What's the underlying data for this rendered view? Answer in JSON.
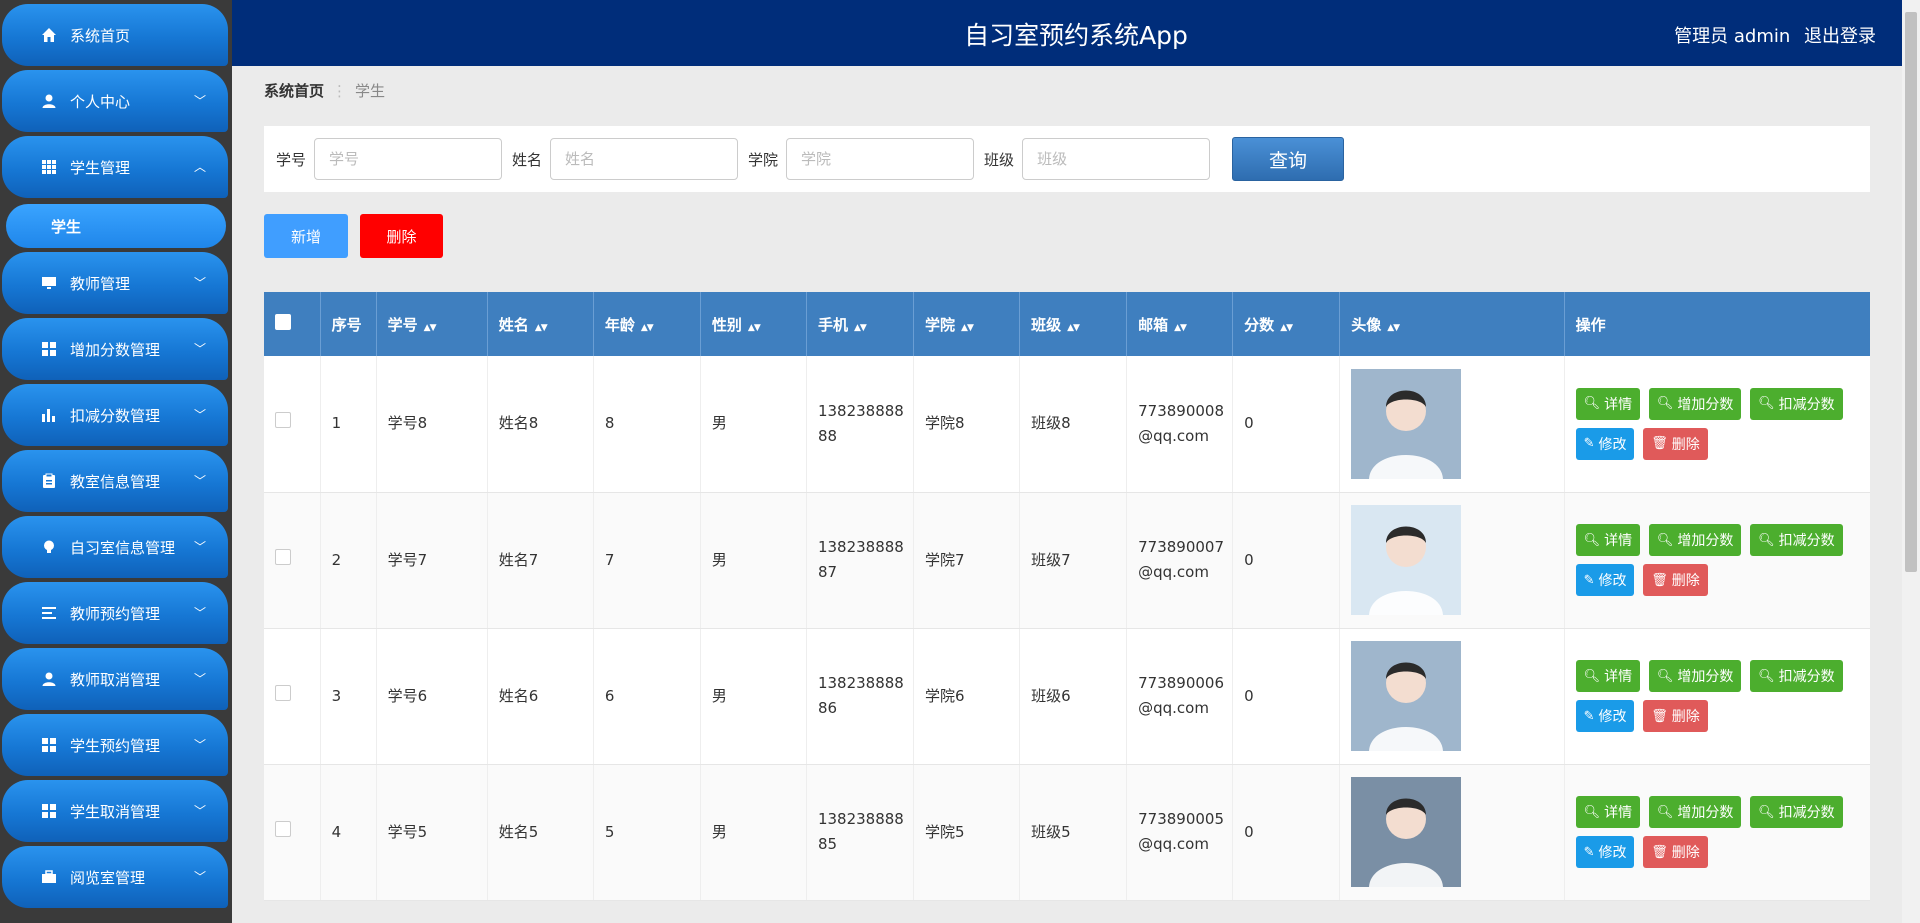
{
  "sidebar": {
    "items": [
      {
        "label": "系统首页",
        "icon": "home-icon"
      },
      {
        "label": "个人中心",
        "icon": "user-icon"
      },
      {
        "label": "学生管理",
        "icon": "grid-icon"
      },
      {
        "label": "教师管理",
        "icon": "monitor-icon"
      },
      {
        "label": "增加分数管理",
        "icon": "grid-icon"
      },
      {
        "label": "扣减分数管理",
        "icon": "bar-chart-icon"
      },
      {
        "label": "教室信息管理",
        "icon": "clipboard-icon"
      },
      {
        "label": "自习室信息管理",
        "icon": "bulb-icon"
      },
      {
        "label": "教师预约管理",
        "icon": "list-icon"
      },
      {
        "label": "教师取消管理",
        "icon": "user-icon"
      },
      {
        "label": "学生预约管理",
        "icon": "grid-icon"
      },
      {
        "label": "学生取消管理",
        "icon": "grid-icon"
      },
      {
        "label": "阅览室管理",
        "icon": "briefcase-icon"
      }
    ],
    "sub_item": "学生"
  },
  "header": {
    "title": "自习室预约系统App",
    "user": "管理员 admin",
    "logout": "退出登录"
  },
  "breadcrumb": {
    "home": "系统首页",
    "current": "学生"
  },
  "search": {
    "fields": [
      {
        "label": "学号",
        "placeholder": "学号"
      },
      {
        "label": "姓名",
        "placeholder": "姓名"
      },
      {
        "label": "学院",
        "placeholder": "学院"
      },
      {
        "label": "班级",
        "placeholder": "班级"
      }
    ],
    "query_label": "查询"
  },
  "actions": {
    "add_label": "新增",
    "delete_label": "删除"
  },
  "table": {
    "columns": [
      "序号",
      "学号",
      "姓名",
      "年龄",
      "性别",
      "手机",
      "学院",
      "班级",
      "邮箱",
      "分数",
      "头像",
      "操作"
    ],
    "rows": [
      {
        "idx": "1",
        "sid": "学号8",
        "name": "姓名8",
        "age": "8",
        "sex": "男",
        "phone1": "138238888",
        "phone2": "88",
        "college": "学院8",
        "cls": "班级8",
        "email1": "773890008",
        "email2": "@qq.com",
        "score": "0",
        "avatar_color": "#9fb6cc"
      },
      {
        "idx": "2",
        "sid": "学号7",
        "name": "姓名7",
        "age": "7",
        "sex": "男",
        "phone1": "138238888",
        "phone2": "87",
        "college": "学院7",
        "cls": "班级7",
        "email1": "773890007",
        "email2": "@qq.com",
        "score": "0",
        "avatar_color": "#d9e7f2"
      },
      {
        "idx": "3",
        "sid": "学号6",
        "name": "姓名6",
        "age": "6",
        "sex": "男",
        "phone1": "138238888",
        "phone2": "86",
        "college": "学院6",
        "cls": "班级6",
        "email1": "773890006",
        "email2": "@qq.com",
        "score": "0",
        "avatar_color": "#9fb6cc"
      },
      {
        "idx": "4",
        "sid": "学号5",
        "name": "姓名5",
        "age": "5",
        "sex": "男",
        "phone1": "138238888",
        "phone2": "85",
        "college": "学院5",
        "cls": "班级5",
        "email1": "773890005",
        "email2": "@qq.com",
        "score": "0",
        "avatar_color": "#7a8fa5"
      }
    ],
    "ops": {
      "detail": "详情",
      "add_score": "增加分数",
      "sub_score": "扣减分数",
      "edit": "修改",
      "delete": "删除"
    }
  }
}
